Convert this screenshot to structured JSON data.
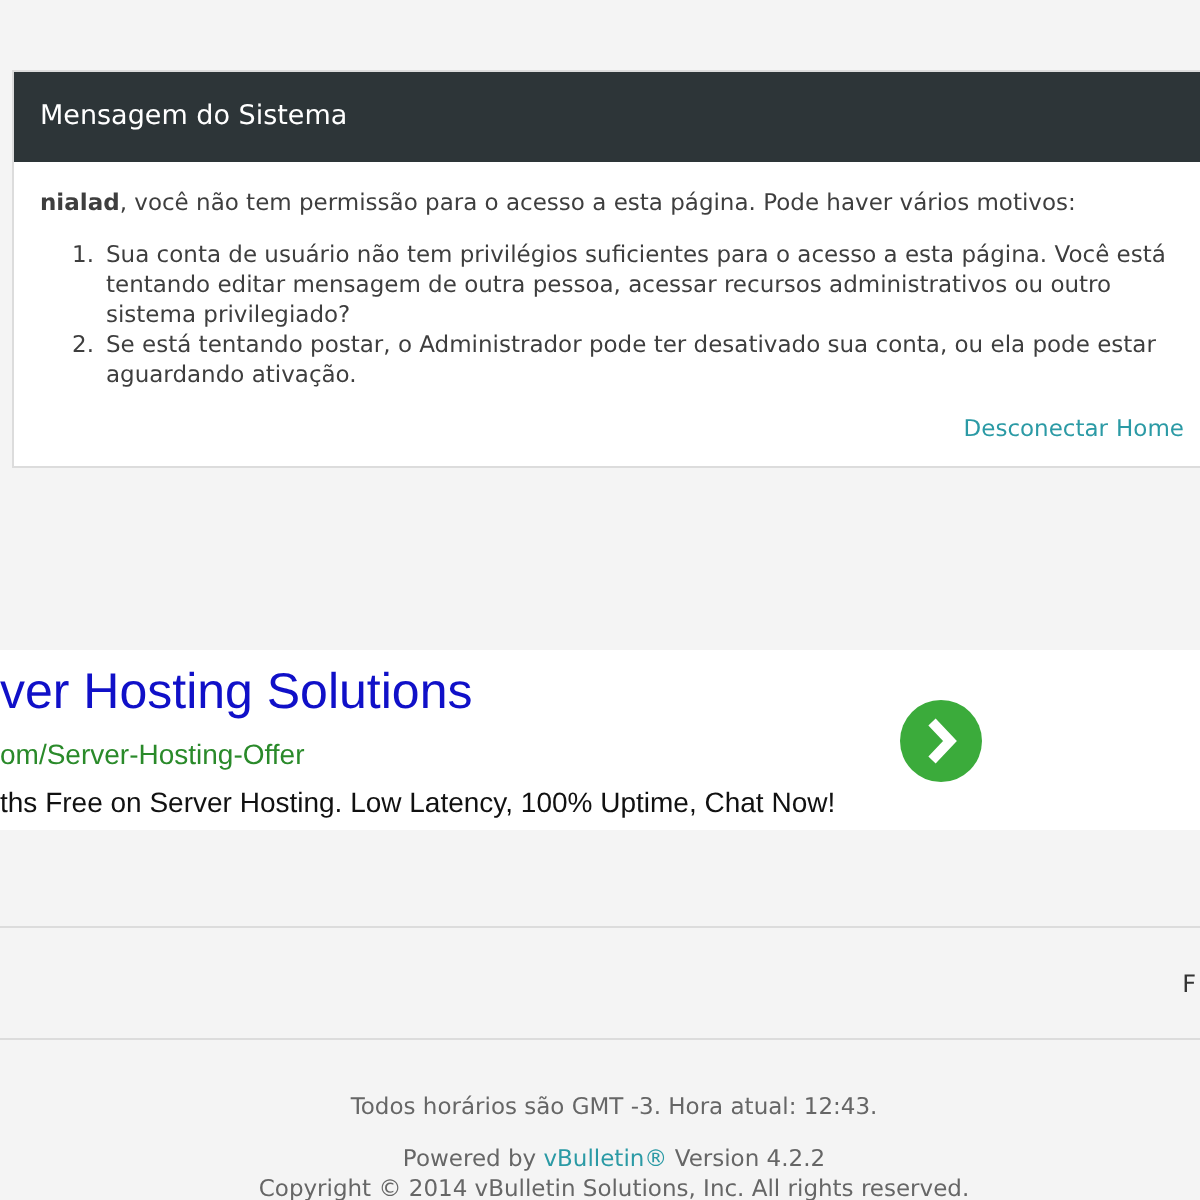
{
  "message_panel": {
    "title": "Mensagem do Sistema",
    "username": "nialad",
    "intro": ", você não tem permissão para o acesso a esta página. Pode haver vários motivos:",
    "reasons": [
      {
        "number": "1.",
        "text": "Sua conta de usuário não tem privilégios suficientes para o acesso a esta página. Você está tentando editar mensagem de outra pessoa, acessar recursos administrativos ou outro sistema privilegiado?"
      },
      {
        "number": "2.",
        "text": "Se está tentando postar, o Administrador pode ter desativado sua conta, ou ela pode estar aguardando ativação."
      }
    ],
    "links": [
      "Desconectar",
      "Home"
    ]
  },
  "ad": {
    "title": "ver Hosting Solutions",
    "url": "om/Server-Hosting-Offer",
    "description": "ths Free on Server Hosting. Low Latency, 100% Uptime, Chat Now!"
  },
  "footer_bar": {
    "link": "F"
  },
  "footer": {
    "timezone": "Todos horários são GMT -3. Hora atual: 12:43.",
    "powered_prefix": "Powered by ",
    "powered_link": "vBulletin®",
    "powered_suffix": " Version 4.2.2",
    "copyright": "Copyright © 2014 vBulletin Solutions, Inc. All rights reserved."
  }
}
